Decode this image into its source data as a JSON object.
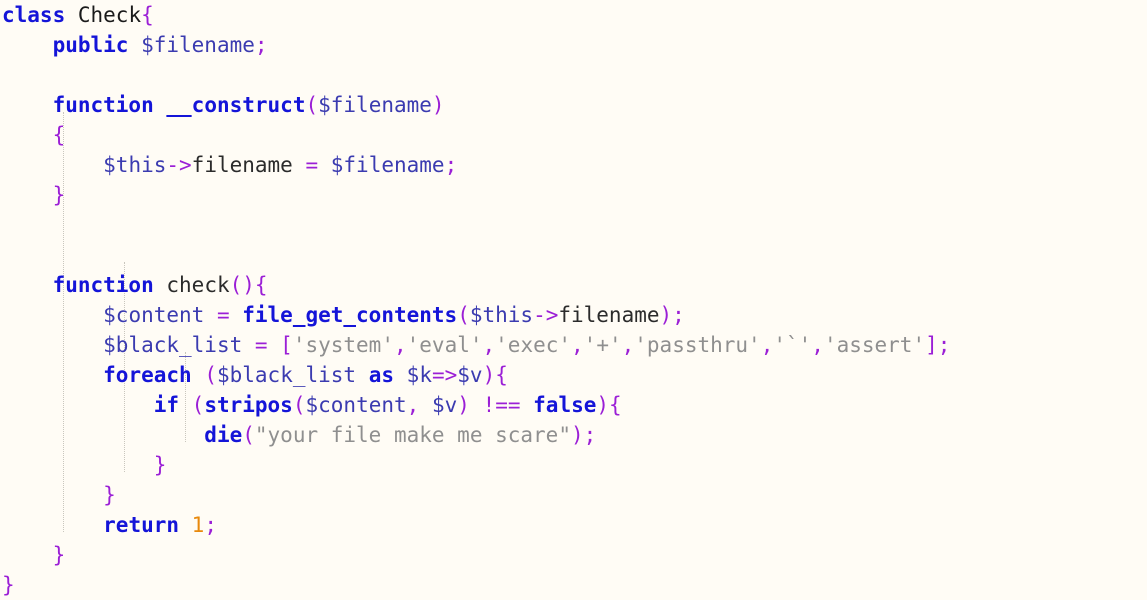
{
  "editor": {
    "language": "php",
    "background_color": "#fffcf5",
    "font_size_px": 21,
    "line_height_px": 30,
    "indent_guides_visible": true,
    "indent_guide_color": "#c9c6bd"
  },
  "theme_colors": {
    "keyword": "#1414d8",
    "function": "#1414d8",
    "class_name": "#1a1a1a",
    "variable": "#3b3bb0",
    "punctuation": "#9b1fd6",
    "string": "#8f8f8f",
    "number": "#e8890c",
    "plain": "#2b2b2b"
  },
  "code": {
    "line_count": 19,
    "lines": [
      {
        "n": 1,
        "indent": 0,
        "text": "class Check{"
      },
      {
        "n": 2,
        "indent": 1,
        "text": "public $filename;"
      },
      {
        "n": 3,
        "indent": 0,
        "text": ""
      },
      {
        "n": 4,
        "indent": 1,
        "text": "function __construct($filename)"
      },
      {
        "n": 5,
        "indent": 1,
        "text": "{"
      },
      {
        "n": 6,
        "indent": 2,
        "text": "$this->filename = $filename;"
      },
      {
        "n": 7,
        "indent": 1,
        "text": "}"
      },
      {
        "n": 8,
        "indent": 0,
        "text": ""
      },
      {
        "n": 9,
        "indent": 0,
        "text": ""
      },
      {
        "n": 10,
        "indent": 1,
        "text": "function check(){"
      },
      {
        "n": 11,
        "indent": 2,
        "text": "$content = file_get_contents($this->filename);"
      },
      {
        "n": 12,
        "indent": 2,
        "text": "$black_list = ['system','eval','exec','+','passthru','`','assert'];"
      },
      {
        "n": 13,
        "indent": 2,
        "text": "foreach ($black_list as $k=>$v){"
      },
      {
        "n": 14,
        "indent": 3,
        "text": "if (stripos($content, $v) !== false){"
      },
      {
        "n": 15,
        "indent": 4,
        "text": "die(\"your file make me scare\");"
      },
      {
        "n": 16,
        "indent": 3,
        "text": "}"
      },
      {
        "n": 17,
        "indent": 2,
        "text": "}"
      },
      {
        "n": 18,
        "indent": 2,
        "text": "return 1;"
      },
      {
        "n": 19,
        "indent": 1,
        "text": "}"
      },
      {
        "n": 20,
        "indent": 0,
        "text": "}"
      }
    ]
  },
  "tokens": {
    "kw_class": "class",
    "name_check": "Check",
    "brace_open": "{",
    "brace_close": "}",
    "kw_public": "public",
    "var_filename": "$filename",
    "semi": ";",
    "kw_function": "function",
    "fn_construct": "__construct",
    "paren_open": "(",
    "paren_close": ")",
    "var_this": "$this",
    "arrow": "->",
    "prop_filename": "filename",
    "eq": " = ",
    "fn_check": "check",
    "var_content": "$content",
    "fn_file_get_contents": "file_get_contents",
    "var_black_list": "$black_list",
    "bracket_open": "[",
    "bracket_close": "]",
    "comma": ",",
    "str_system": "'system'",
    "str_eval": "'eval'",
    "str_exec": "'exec'",
    "str_plus": "'+'",
    "str_passthru": "'passthru'",
    "str_backtick": "'`'",
    "str_assert": "'assert'",
    "kw_foreach": "foreach",
    "kw_as": "as",
    "var_k": "$k",
    "fat_arrow": "=>",
    "var_v": "$v",
    "kw_if": "if",
    "fn_stripos": "stripos",
    "comma_space": ", ",
    "not_identical": "!==",
    "kw_false": "false",
    "fn_die": "die",
    "str_scare": "\"your file make me scare\"",
    "kw_return": "return",
    "num_one": "1",
    "space": " "
  },
  "blacklist_values": [
    "system",
    "eval",
    "exec",
    "+",
    "passthru",
    "`",
    "assert"
  ],
  "die_message": "your file make me scare"
}
